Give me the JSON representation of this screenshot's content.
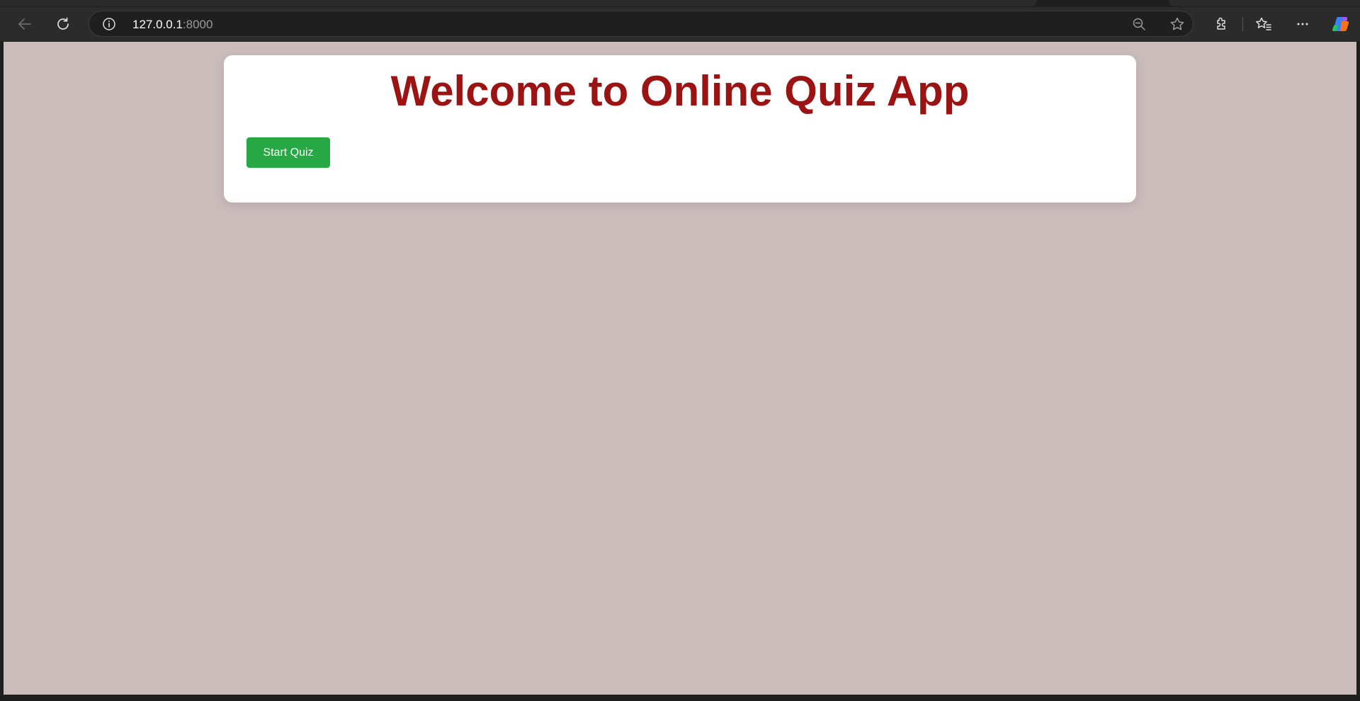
{
  "browser": {
    "url_host": "127.0.0.1",
    "url_port": ":8000",
    "icons": {
      "back": "back-arrow-icon",
      "reload": "reload-icon",
      "site_info": "info-icon",
      "zoom": "zoom-out-icon",
      "favorite": "star-icon",
      "extensions": "puzzle-icon",
      "favorites_bar": "favorites-icon",
      "menu": "more-icon",
      "copilot": "copilot-icon"
    }
  },
  "page": {
    "title": "Welcome to Online Quiz App",
    "start_button_label": "Start Quiz"
  },
  "colors": {
    "page_background": "#cbbcbc",
    "title": "#9b1313",
    "button": "#28a745",
    "card": "#ffffff"
  }
}
